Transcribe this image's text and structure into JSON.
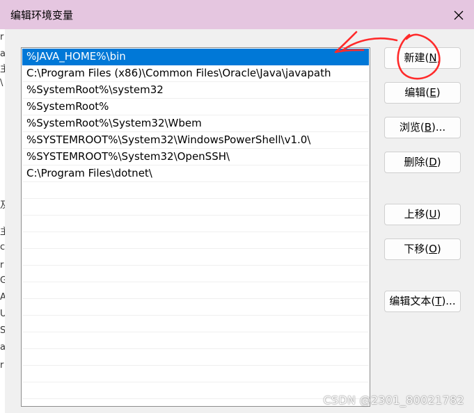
{
  "dialog": {
    "title": "编辑环境变量"
  },
  "path_list": {
    "items": [
      "%JAVA_HOME%\\bin",
      "C:\\Program Files (x86)\\Common Files\\Oracle\\Java\\javapath",
      "%SystemRoot%\\system32",
      "%SystemRoot%",
      "%SystemRoot%\\System32\\Wbem",
      "%SYSTEMROOT%\\System32\\WindowsPowerShell\\v1.0\\",
      "%SYSTEMROOT%\\System32\\OpenSSH\\",
      "C:\\Program Files\\dotnet\\"
    ],
    "selected_index": 0
  },
  "buttons": {
    "new": {
      "text": "新建(",
      "key": "N",
      "end": ")"
    },
    "edit": {
      "text": "编辑(",
      "key": "E",
      "end": ")"
    },
    "browse": {
      "text": "浏览(",
      "key": "B",
      "end": ")..."
    },
    "delete": {
      "text": "删除(",
      "key": "D",
      "end": ")"
    },
    "move_up": {
      "text": "上移(",
      "key": "U",
      "end": ")"
    },
    "move_down": {
      "text": "下移(",
      "key": "O",
      "end": ")"
    },
    "edit_text": {
      "text": "编辑文本(",
      "key": "T",
      "end": ")..."
    }
  },
  "background_window": {
    "chars": [
      "生",
      "r",
      "a",
      "主",
      "\\",
      "及",
      "主",
      "c",
      "r",
      "G",
      "A",
      "U",
      "S",
      "a",
      "r"
    ]
  },
  "watermark": "CSDN @2301_80021782",
  "colors": {
    "titlebar": "#e5c6e0",
    "selection": "#0078d7",
    "annotation": "#ff2a2a"
  }
}
